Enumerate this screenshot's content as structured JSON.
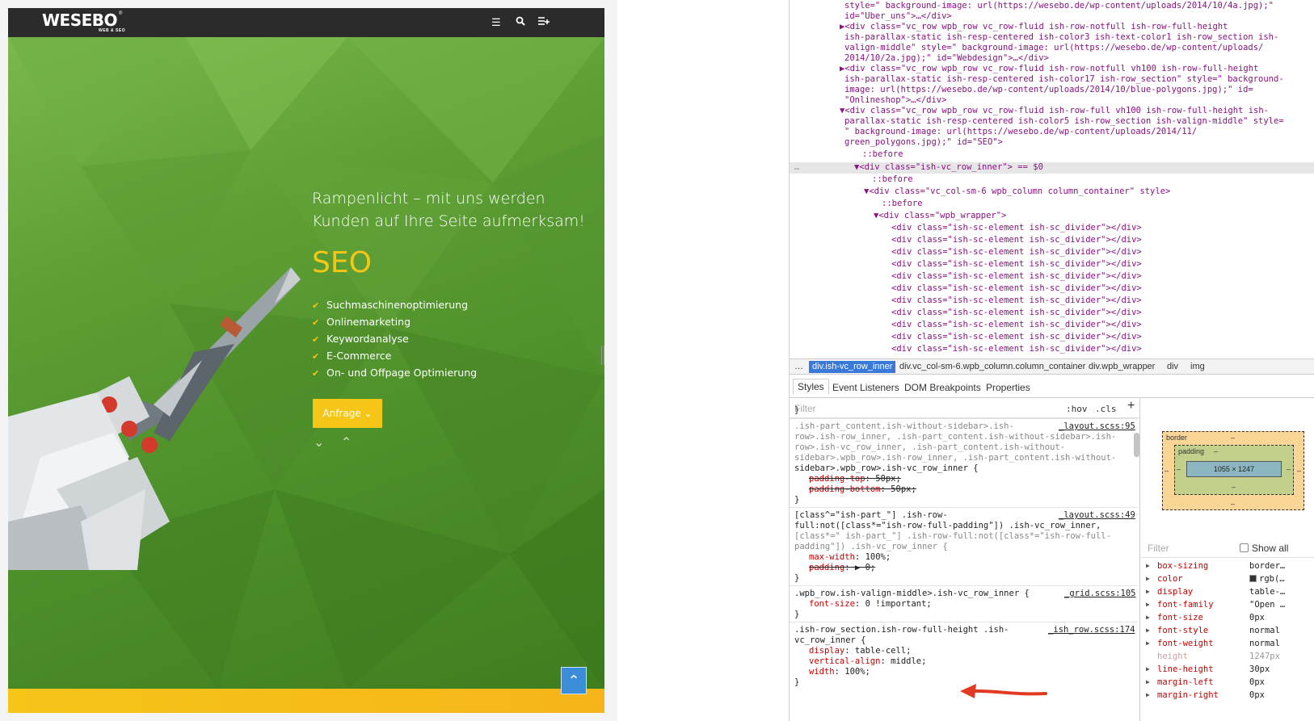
{
  "site": {
    "logo": "WESEBO",
    "logo_sub": "WEB & SEO",
    "logo_reg": "®",
    "header_icons": [
      "menu-icon",
      "search-icon",
      "add-list-icon"
    ],
    "hero": {
      "title": "Rampenlicht – mit uns werden Kunden auf Ihre Seite aufmerksam!",
      "heading": "SEO",
      "list": [
        "Suchmaschinenoptimierung",
        "Onlinemarketing",
        "Keywordanalyse",
        "E-Commerce",
        "On- und Offpage Optimierung"
      ],
      "cta_label": "Anfrage ⌄",
      "scroll_arrows": "⌄ ⌃",
      "to_top": "⌃"
    },
    "colors": {
      "green": "#4e902a",
      "yellow": "#f5c518",
      "header": "#2b2b2b",
      "to_top": "#3a8dd6"
    }
  },
  "devtools": {
    "dom": [
      "style=\" background-image: url(https://wesebo.de/wp-content/uploads/2014/10/4a.jpg);\"",
      "id=\"Uber_uns\">…</div>",
      "▶<div class=\"vc_row wpb_row vc_row-fluid ish-row-notfull ish-row-full-height",
      "ish-parallax-static ish-resp-centered ish-color3 ish-text-color1 ish-row_section ish-",
      "valign-middle\" style=\" background-image: url(https://wesebo.de/wp-content/uploads/",
      "2014/10/2a.jpg);\" id=\"Webdesign\">…</div>",
      "▶<div class=\"vc_row wpb_row vc_row-fluid ish-row-notfull vh100 ish-row-full-height",
      "ish-parallax-static ish-resp-centered ish-color17 ish-row_section\" style=\" background-",
      "image: url(https://wesebo.de/wp-content/uploads/2014/10/blue-polygons.jpg);\" id=",
      "\"Onlineshop\">…</div>",
      "▼<div class=\"vc_row wpb_row vc_row-fluid ish-row-full vh100 ish-row-full-height ish-",
      "parallax-static ish-resp-centered ish-color5 ish-row_section ish-valign-middle\" style=",
      "\" background-image: url(https://wesebo.de/wp-content/uploads/2014/11/",
      "green_polygons.jpg);\" id=\"SEO\">",
      "::before",
      "▼<div class=\"ish-vc_row_inner\"> == $0",
      "::before",
      "▼<div class=\"vc_col-sm-6 wpb_column column_container\" style>",
      "::before",
      "▼<div class=\"wpb_wrapper\">",
      "<div class=\"ish-sc-element ish-sc_divider\"></div>",
      "<div class=\"ish-sc-element ish-sc_divider\"></div>",
      "<div class=\"ish-sc-element ish-sc_divider\"></div>",
      "<div class=\"ish-sc-element ish-sc_divider\"></div>",
      "<div class=\"ish-sc-element ish-sc_divider\"></div>",
      "<div class=\"ish-sc-element ish-sc_divider\"></div>",
      "<div class=\"ish-sc-element ish-sc_divider\"></div>",
      "<div class=\"ish-sc-element ish-sc_divider\"></div>",
      "<div class=\"ish-sc-element ish-sc_divider\"></div>",
      "<div class=\"ish-sc-element ish-sc_divider\"></div>",
      "<div class=\"ish-sc-element ish-sc_divider\"></div>"
    ],
    "selected_marker": "…",
    "breadcrumb": [
      "…",
      "div.ish-vc_row_inner",
      "div.vc_col-sm-6.wpb_column.column_container",
      "div.wpb_wrapper",
      "div",
      "img"
    ],
    "tabs": [
      "Styles",
      "Event Listeners",
      "DOM Breakpoints",
      "Properties"
    ],
    "styles_filter": "Filter",
    "hov": ":hov",
    "cls": ".cls",
    "add": "+",
    "rules": [
      {
        "text": "}"
      },
      {
        "text": ".ish-part_content.ish-without-sidebar>.ish-",
        "src": "_layout.scss:95"
      },
      {
        "text": "row>.ish-row_inner, .ish-part_content.ish-without-sidebar>.ish-"
      },
      {
        "text": "row>.ish-vc_row_inner, .ish-part_content.ish-without-"
      },
      {
        "text": "sidebar>.wpb_row>.ish-row_inner, .ish-part_content.ish-without-"
      },
      {
        "text": "sidebar>.wpb_row>.ish-vc_row_inner {"
      },
      {
        "prop": "padding-top",
        "val": "50px;",
        "strike": true
      },
      {
        "prop": "padding-bottom",
        "val": "50px;",
        "strike": true
      },
      {
        "text": "}"
      },
      {
        "text": "[class^=\"ish-part_\"] .ish-row-",
        "src": "_layout.scss:49"
      },
      {
        "text": "full:not([class*=\"ish-row-full-padding\"]) .ish-vc_row_inner,"
      },
      {
        "text": "[class*=\" ish-part_\"] .ish-row-full:not([class*=\"ish-row-full-"
      },
      {
        "text": "padding\"]) .ish-vc_row_inner {"
      },
      {
        "prop": "max-width",
        "val": "100%;"
      },
      {
        "prop": "padding",
        "val": "▶ 0;",
        "strike": true
      },
      {
        "text": "}"
      },
      {
        "text": ".wpb_row.ish-valign-middle>.ish-vc_row_inner {",
        "src": "_grid.scss:105"
      },
      {
        "prop": "font-size",
        "val": "0 !important;"
      },
      {
        "text": "}"
      },
      {
        "text": ".ish-row_section.ish-row-full-height .ish-",
        "src": "_ish_row.scss:174"
      },
      {
        "text": "vc_row_inner {"
      },
      {
        "prop": "display",
        "val": "table-cell;"
      },
      {
        "prop": "vertical-align",
        "val": "middle;"
      },
      {
        "prop": "width",
        "val": "100%;"
      },
      {
        "text": "}"
      }
    ],
    "boxmodel": {
      "border_label": "border",
      "border_val": "–",
      "padding_label": "padding",
      "padding_val": "–",
      "content": "1055 × 1247",
      "side_dash": "–"
    },
    "computed_filter": "Filter",
    "show_all": "Show all",
    "computed": [
      {
        "name": "box-sizing",
        "value": "border…"
      },
      {
        "name": "color",
        "value": "rgb(…"
      },
      {
        "name": "display",
        "value": "table-…"
      },
      {
        "name": "font-family",
        "value": "\"Open …"
      },
      {
        "name": "font-size",
        "value": "0px"
      },
      {
        "name": "font-style",
        "value": "normal"
      },
      {
        "name": "font-weight",
        "value": "normal"
      },
      {
        "name": "height",
        "value": "1247px",
        "inherited": true
      },
      {
        "name": "line-height",
        "value": "30px"
      },
      {
        "name": "margin-left",
        "value": "0px"
      },
      {
        "name": "margin-right",
        "value": "0px"
      }
    ]
  }
}
